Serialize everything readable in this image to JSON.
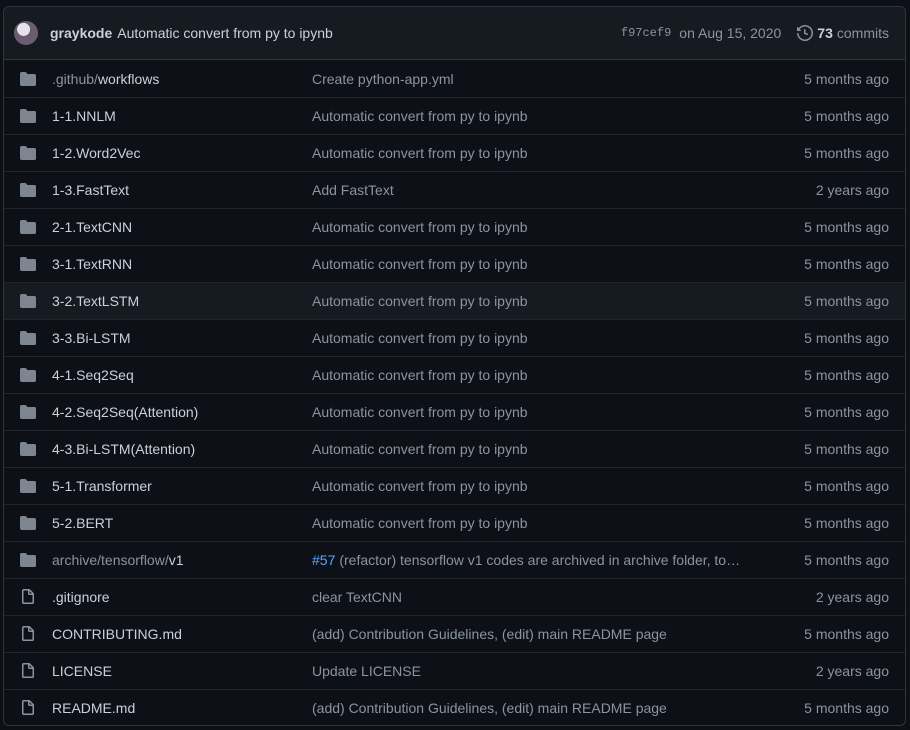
{
  "latest_commit": {
    "author": "graykode",
    "message": "Automatic convert from py to ipynb",
    "sha": "f97cef9",
    "date": "on Aug 15, 2020",
    "commit_count": "73",
    "commits_label": "commits",
    "history_icon": "history-icon"
  },
  "colors": {
    "folder": "#7d8590",
    "link": "#58a6ff",
    "background": "#0d1117"
  },
  "files": [
    {
      "type": "dir",
      "path_prefix": ".github/",
      "name": "workflows",
      "message": "Create python-app.yml",
      "age": "5 months ago"
    },
    {
      "type": "dir",
      "path_prefix": "",
      "name": "1-1.NNLM",
      "message": "Automatic convert from py to ipynb",
      "age": "5 months ago"
    },
    {
      "type": "dir",
      "path_prefix": "",
      "name": "1-2.Word2Vec",
      "message": "Automatic convert from py to ipynb",
      "age": "5 months ago"
    },
    {
      "type": "dir",
      "path_prefix": "",
      "name": "1-3.FastText",
      "message": "Add FastText",
      "age": "2 years ago"
    },
    {
      "type": "dir",
      "path_prefix": "",
      "name": "2-1.TextCNN",
      "message": "Automatic convert from py to ipynb",
      "age": "5 months ago"
    },
    {
      "type": "dir",
      "path_prefix": "",
      "name": "3-1.TextRNN",
      "message": "Automatic convert from py to ipynb",
      "age": "5 months ago"
    },
    {
      "type": "dir",
      "path_prefix": "",
      "name": "3-2.TextLSTM",
      "message": "Automatic convert from py to ipynb",
      "age": "5 months ago",
      "highlight": true
    },
    {
      "type": "dir",
      "path_prefix": "",
      "name": "3-3.Bi-LSTM",
      "message": "Automatic convert from py to ipynb",
      "age": "5 months ago"
    },
    {
      "type": "dir",
      "path_prefix": "",
      "name": "4-1.Seq2Seq",
      "message": "Automatic convert from py to ipynb",
      "age": "5 months ago"
    },
    {
      "type": "dir",
      "path_prefix": "",
      "name": "4-2.Seq2Seq(Attention)",
      "message": "Automatic convert from py to ipynb",
      "age": "5 months ago"
    },
    {
      "type": "dir",
      "path_prefix": "",
      "name": "4-3.Bi-LSTM(Attention)",
      "message": "Automatic convert from py to ipynb",
      "age": "5 months ago"
    },
    {
      "type": "dir",
      "path_prefix": "",
      "name": "5-1.Transformer",
      "message": "Automatic convert from py to ipynb",
      "age": "5 months ago"
    },
    {
      "type": "dir",
      "path_prefix": "",
      "name": "5-2.BERT",
      "message": "Automatic convert from py to ipynb",
      "age": "5 months ago"
    },
    {
      "type": "dir",
      "path_prefix": "archive/tensorflow/",
      "name": "v1",
      "pr": "#57",
      "message": "(refactor) tensorflow v1 codes are archived in archive folder, to…",
      "age": "5 months ago"
    },
    {
      "type": "file",
      "path_prefix": "",
      "name": ".gitignore",
      "message": "clear TextCNN",
      "age": "2 years ago"
    },
    {
      "type": "file",
      "path_prefix": "",
      "name": "CONTRIBUTING.md",
      "message": "(add) Contribution Guidelines, (edit) main README page",
      "age": "5 months ago"
    },
    {
      "type": "file",
      "path_prefix": "",
      "name": "LICENSE",
      "message": "Update LICENSE",
      "age": "2 years ago"
    },
    {
      "type": "file",
      "path_prefix": "",
      "name": "README.md",
      "message": "(add) Contribution Guidelines, (edit) main README page",
      "age": "5 months ago"
    }
  ]
}
